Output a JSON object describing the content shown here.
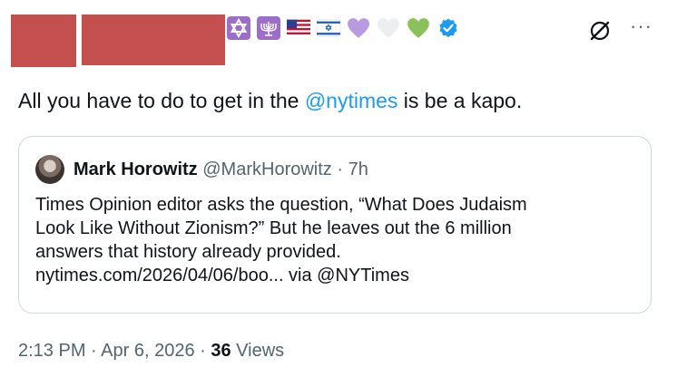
{
  "header": {
    "emojis": [
      "star-of-david-icon",
      "menorah-icon",
      "us-flag-icon",
      "israel-flag-icon",
      "purple-heart-icon",
      "white-heart-icon",
      "green-heart-icon",
      "verified-badge-icon"
    ],
    "redaction_color": "#c44f4f"
  },
  "tweet": {
    "text_before": "All you have to do to get in the ",
    "mention": "@nytimes",
    "text_after": " is be a kapo."
  },
  "quote": {
    "name": "Mark Horowitz",
    "handle": "@MarkHorowitz",
    "separator": " · ",
    "time": "7h",
    "lines": [
      "Times Opinion editor asks the question, “What Does Judaism",
      "Look Like Without Zionism?” But he leaves out the 6 million",
      "answers that history already provided.",
      "nytimes.com/2026/04/06/boo... via @NYTimes"
    ]
  },
  "meta": {
    "time": "2:13 PM",
    "sep1": " · ",
    "date": "Apr 6, 2026",
    "sep2": " · ",
    "views_count": "36",
    "views_label": " Views"
  },
  "colors": {
    "accent": "#1d9bf0",
    "secondary_text": "#536471",
    "border": "#cfd9de"
  }
}
